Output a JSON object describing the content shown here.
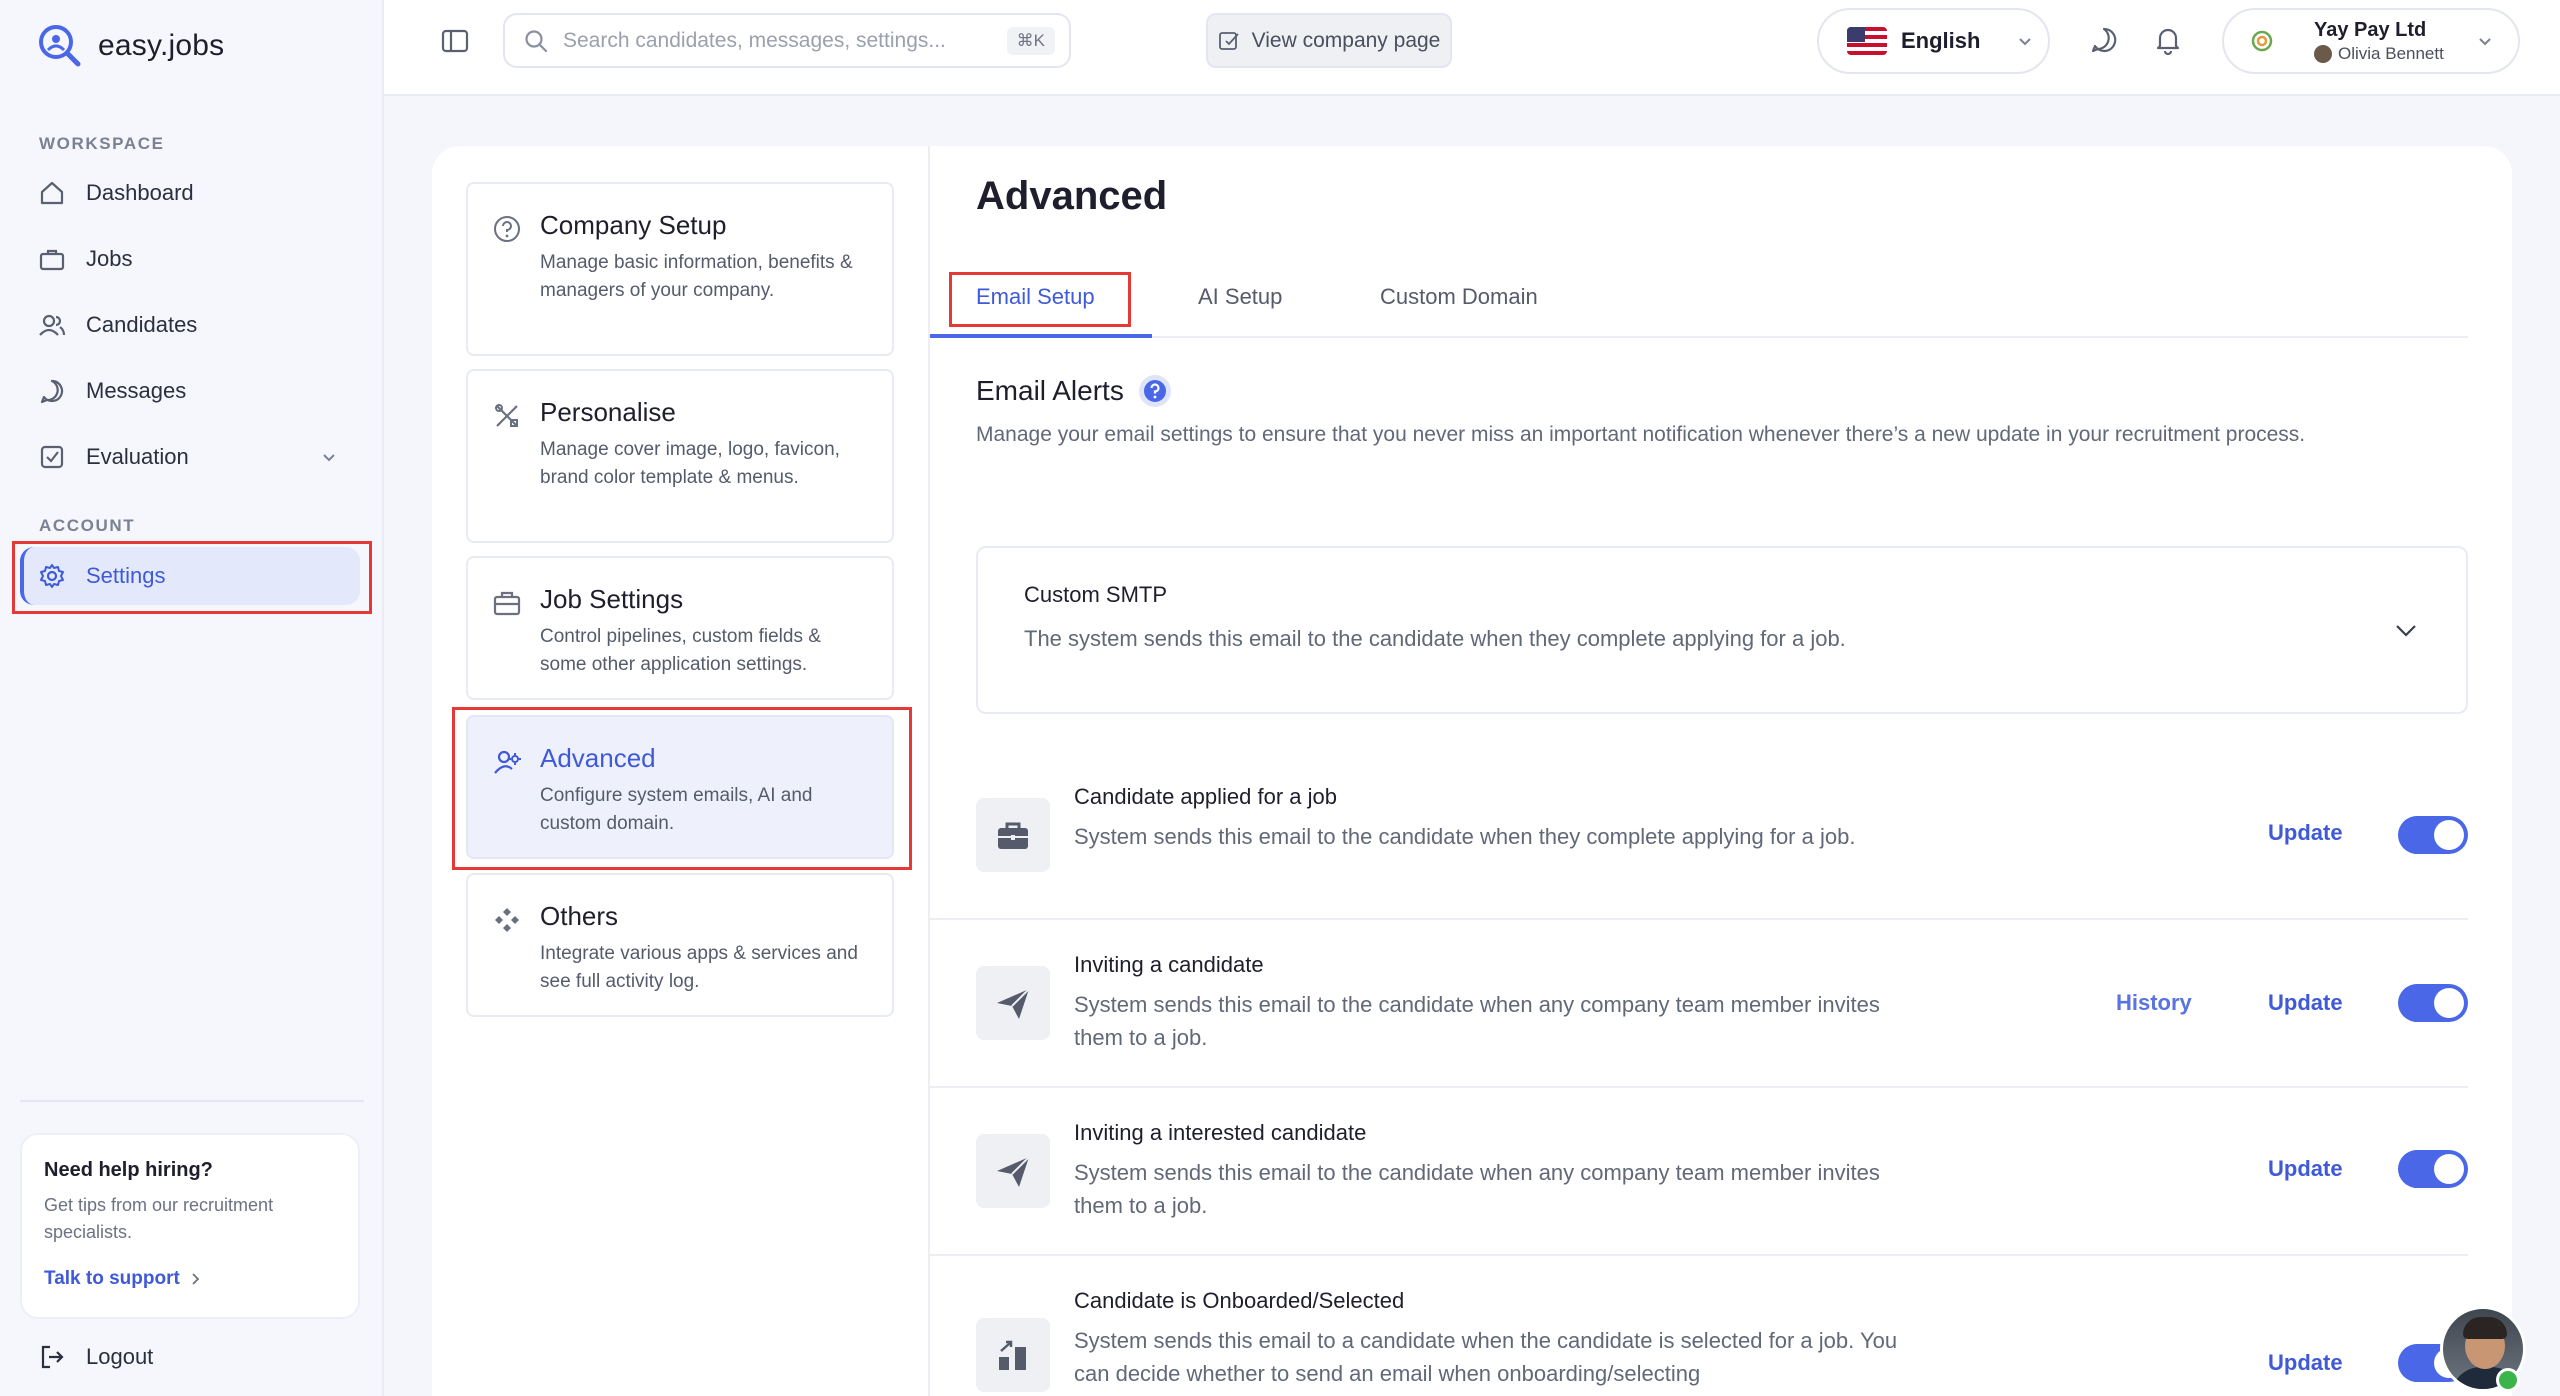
{
  "brand": {
    "name": "easy.jobs"
  },
  "sidebar": {
    "workspace_label": "WORKSPACE",
    "account_label": "ACCOUNT",
    "items": [
      {
        "label": "Dashboard",
        "icon": "home-icon"
      },
      {
        "label": "Jobs",
        "icon": "briefcase-icon"
      },
      {
        "label": "Candidates",
        "icon": "users-icon"
      },
      {
        "label": "Messages",
        "icon": "message-icon"
      },
      {
        "label": "Evaluation",
        "icon": "checklist-icon"
      }
    ],
    "settings_label": "Settings",
    "help": {
      "title": "Need help hiring?",
      "text": "Get tips from our recruitment specialists.",
      "link": "Talk to support"
    },
    "logout_label": "Logout"
  },
  "topbar": {
    "search_placeholder": "Search candidates, messages, settings...",
    "search_shortcut": "⌘K",
    "view_company_label": "View company page",
    "language": "English",
    "company_name": "Yay Pay Ltd",
    "user_name": "Olivia Bennett"
  },
  "settings_nav": [
    {
      "title": "Company Setup",
      "desc": "Manage basic information, benefits & managers of your company."
    },
    {
      "title": "Personalise",
      "desc": "Manage cover image, logo, favicon, brand color template & menus."
    },
    {
      "title": "Job Settings",
      "desc": "Control pipelines, custom fields & some other application settings."
    },
    {
      "title": "Advanced",
      "desc": "Configure system emails, AI and custom domain."
    },
    {
      "title": "Others",
      "desc": "Integrate various apps & services and see full activity log."
    }
  ],
  "main": {
    "title": "Advanced",
    "tabs": [
      "Email Setup",
      "AI Setup",
      "Custom Domain"
    ],
    "alerts_title": "Email Alerts",
    "alerts_desc": "Manage your email settings to ensure that you never miss an important notification whenever there’s a new update in your recruitment process.",
    "smtp": {
      "title": "Custom SMTP",
      "desc": "The system sends this email to the candidate when they complete applying for a job."
    },
    "update_label": "Update",
    "history_label": "History",
    "alerts": [
      {
        "title": "Candidate applied for a job",
        "desc": "System sends this email to the candidate when they complete applying for a job.",
        "enabled": true
      },
      {
        "title": "Inviting a candidate",
        "desc": "System sends this email to the candidate when any company team member invites them to a job.",
        "enabled": true
      },
      {
        "title": "Inviting a interested candidate",
        "desc": "System sends this email to the candidate when any company team member invites them to a job.",
        "enabled": true
      },
      {
        "title": "Candidate is Onboarded/Selected",
        "desc": "System sends this email to a candidate when the candidate is selected for a job. You can decide whether to send an email when onboarding/selecting",
        "enabled": true
      }
    ]
  },
  "colors": {
    "accent": "#4a67e8",
    "highlight": "#e53935",
    "online": "#3bb54a"
  }
}
